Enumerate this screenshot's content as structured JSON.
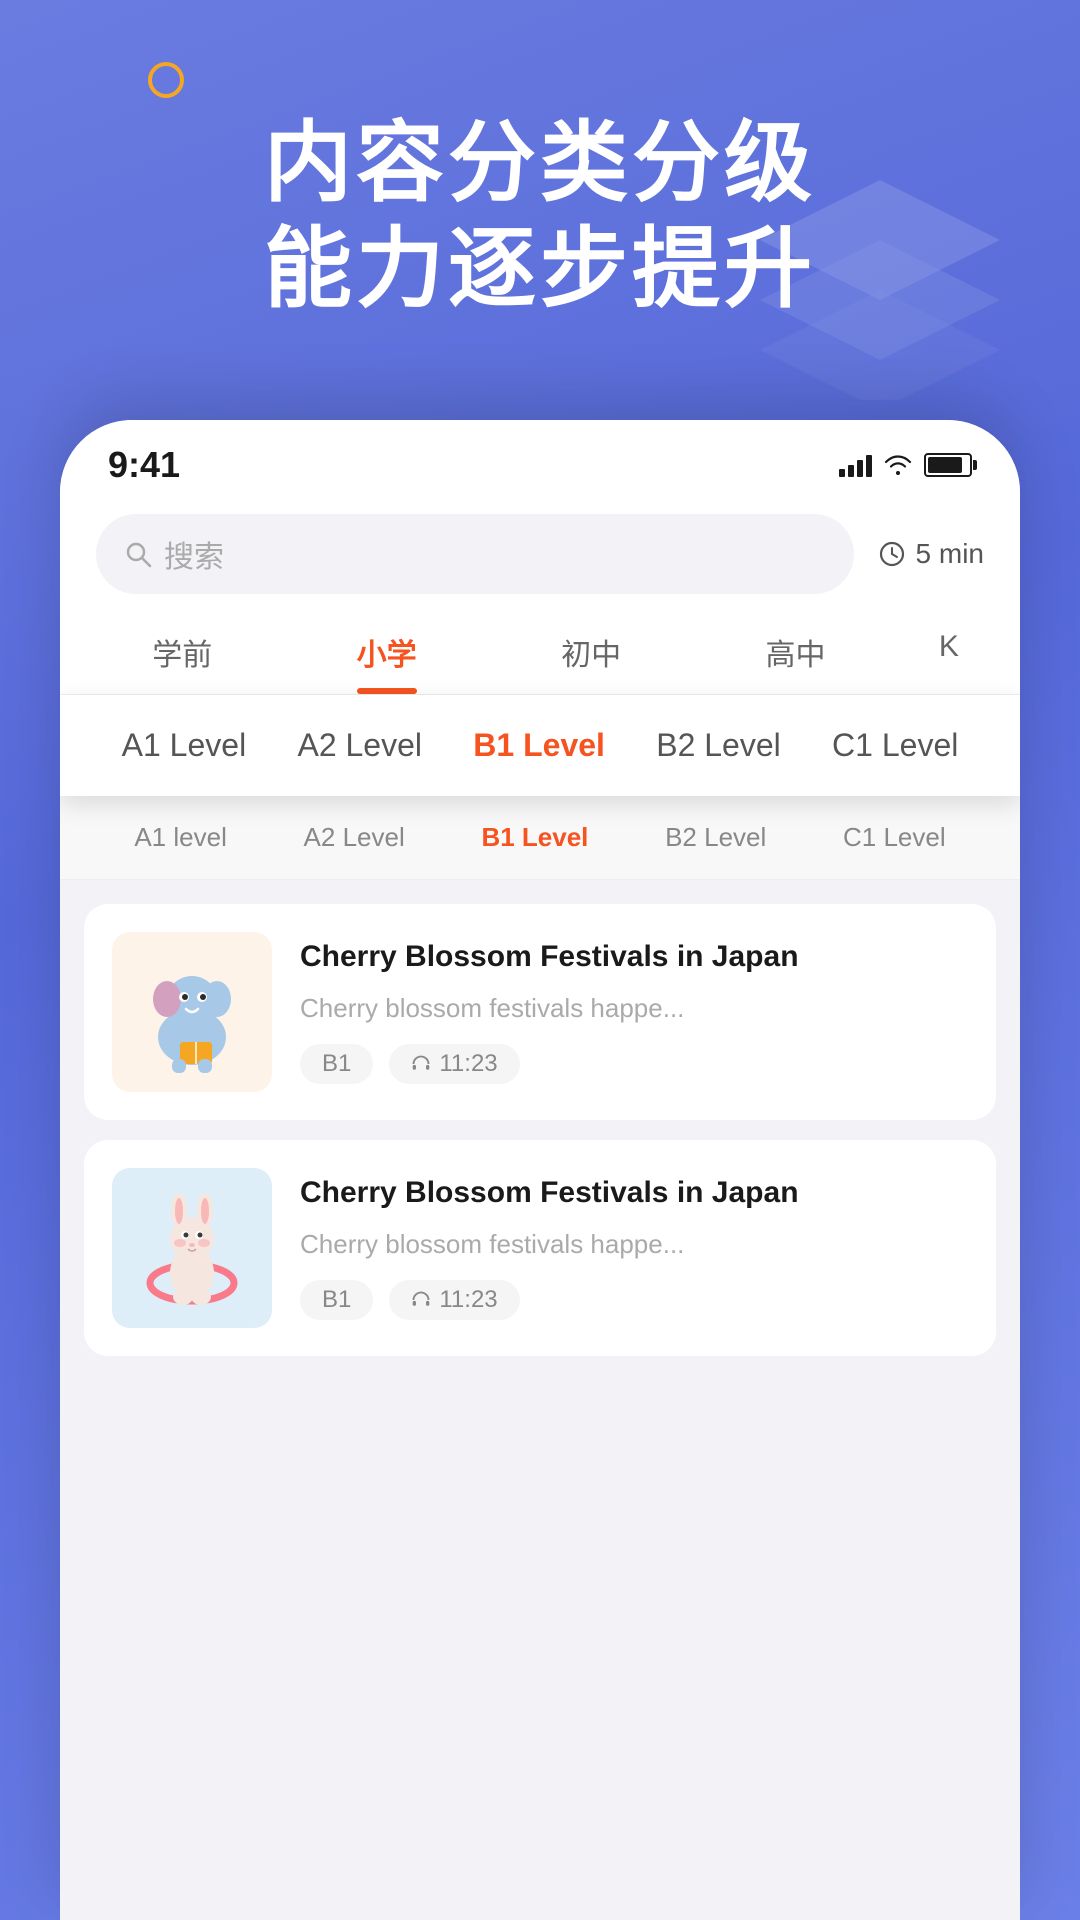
{
  "background": {
    "colors": {
      "primary": "#5b6bdf",
      "accent": "#f5a623",
      "red": "#f5531f"
    }
  },
  "hero": {
    "line1": "内容分类分级",
    "line2": "能力逐步提升"
  },
  "statusBar": {
    "time": "9:41"
  },
  "search": {
    "placeholder": "搜索",
    "timeFilter": "5 min"
  },
  "categoryTabs": [
    {
      "label": "学前",
      "active": false
    },
    {
      "label": "小学",
      "active": true
    },
    {
      "label": "初中",
      "active": false
    },
    {
      "label": "高中",
      "active": false
    },
    {
      "label": "K",
      "active": false
    }
  ],
  "levelOverlay": [
    {
      "label": "A1 Level",
      "active": false
    },
    {
      "label": "A2 Level",
      "active": false
    },
    {
      "label": "B1 Level",
      "active": true
    },
    {
      "label": "B2 Level",
      "active": false
    },
    {
      "label": "C1 Level",
      "active": false
    }
  ],
  "subLevelTabs": [
    {
      "label": "A1 level",
      "active": false
    },
    {
      "label": "A2 Level",
      "active": false
    },
    {
      "label": "B1 Level",
      "active": true
    },
    {
      "label": "B2 Level",
      "active": false
    },
    {
      "label": "C1 Level",
      "active": false
    }
  ],
  "cards": [
    {
      "title": "Cherry Blossom Festivals in Japan",
      "description": "Cherry blossom festivals happe...",
      "level": "B1",
      "duration": "11:23",
      "imageType": "beige"
    },
    {
      "title": "Cherry Blossom Festivals in Japan",
      "description": "Cherry blossom festivals happe...",
      "level": "B1",
      "duration": "11:23",
      "imageType": "blue"
    }
  ]
}
